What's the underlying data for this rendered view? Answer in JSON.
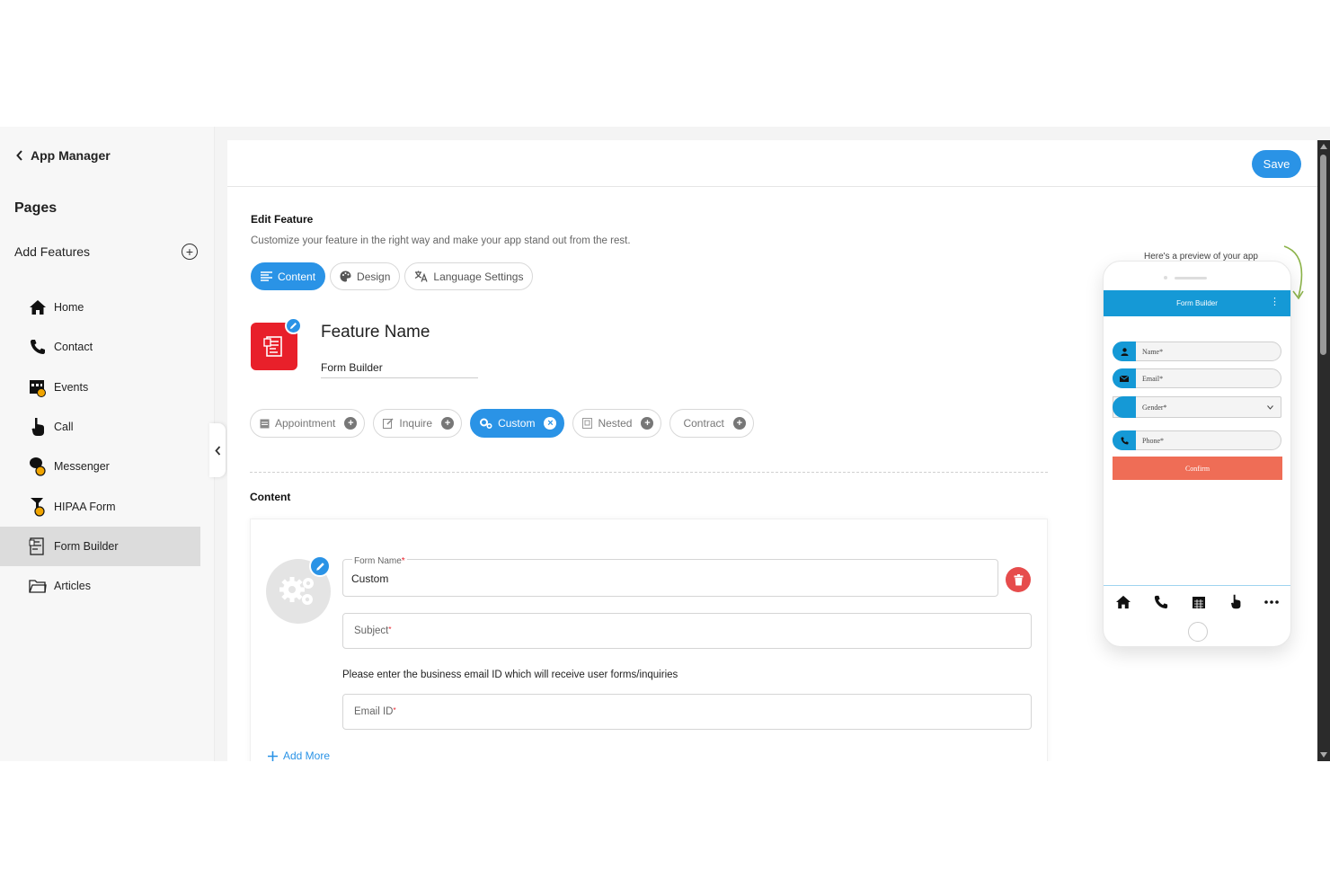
{
  "sidebar": {
    "back_label": "App Manager",
    "pages_title": "Pages",
    "add_features_label": "Add Features",
    "items": [
      {
        "label": "Home",
        "icon": "home-icon"
      },
      {
        "label": "Contact",
        "icon": "phone-icon"
      },
      {
        "label": "Events",
        "icon": "calendar-icon"
      },
      {
        "label": "Call",
        "icon": "call-hand-icon"
      },
      {
        "label": "Messenger",
        "icon": "messenger-icon"
      },
      {
        "label": "HIPAA Form",
        "icon": "hipaa-form-icon"
      },
      {
        "label": "Form Builder",
        "icon": "form-builder-icon",
        "active": true
      },
      {
        "label": "Articles",
        "icon": "folder-icon"
      }
    ]
  },
  "header": {
    "save_label": "Save"
  },
  "editor": {
    "title": "Edit Feature",
    "subtitle": "Customize your feature in the right way and make your app stand out from the rest.",
    "tabs": [
      {
        "label": "Content",
        "active": true
      },
      {
        "label": "Design"
      },
      {
        "label": "Language Settings"
      }
    ],
    "feature_name_title": "Feature Name",
    "feature_name_value": "Form Builder",
    "form_types": [
      {
        "label": "Appointment"
      },
      {
        "label": "Inquire"
      },
      {
        "label": "Custom",
        "active": true
      },
      {
        "label": "Nested"
      },
      {
        "label": "Contract"
      }
    ],
    "content_title": "Content",
    "form": {
      "form_name_label": "Form Name",
      "form_name_value": "Custom",
      "subject_placeholder": "Subject",
      "email_hint": "Please enter the business email ID which will receive user forms/inquiries",
      "email_placeholder": "Email ID",
      "required_mark": "*",
      "add_more_label": "Add More"
    }
  },
  "preview": {
    "label": "Here's a preview of your app",
    "app_title": "Form Builder",
    "fields": [
      {
        "label": "Name*",
        "icon": "person-icon"
      },
      {
        "label": "Email*",
        "icon": "envelope-icon"
      },
      {
        "label": "Gender*",
        "icon": "gender-icon"
      },
      {
        "label": "Phone*",
        "icon": "phone-icon"
      }
    ],
    "confirm_label": "Confirm",
    "tabbar": [
      "home-icon",
      "phone-icon",
      "calendar-icon",
      "call-hand-icon",
      "more-icon"
    ]
  },
  "colors": {
    "accent": "#2a93e6",
    "feature_icon_bg": "#e8202a",
    "preview_header": "#1599d6",
    "preview_confirm": "#ef6d56",
    "delete": "#e64c4c"
  }
}
